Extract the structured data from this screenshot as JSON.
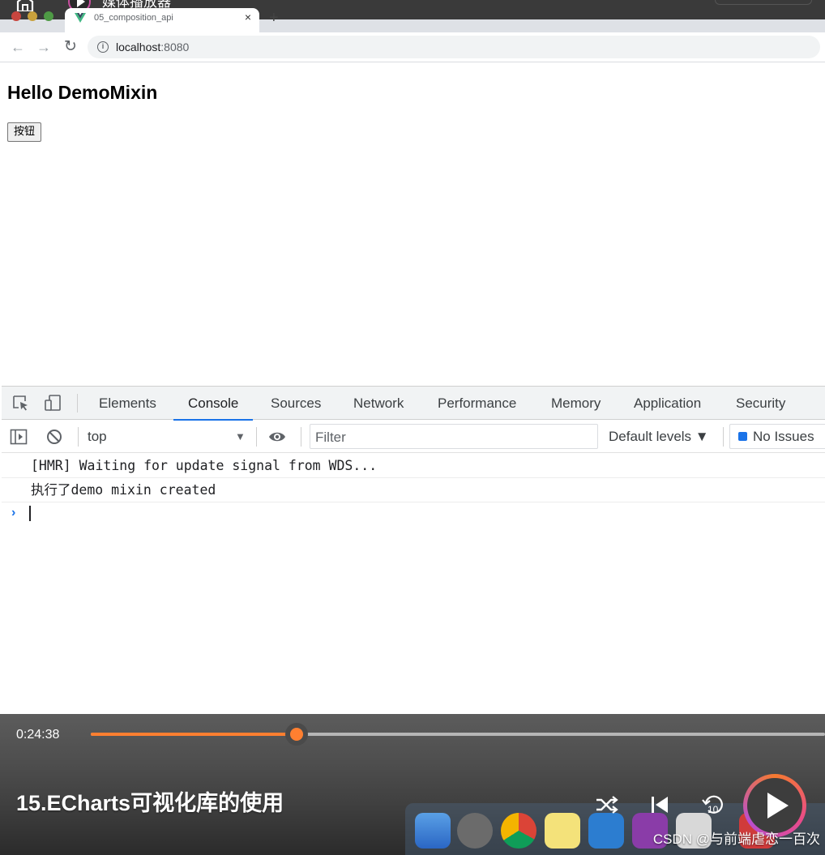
{
  "player": {
    "app_title": "媒体播放器",
    "current_time": "0:24:38",
    "progress_fraction": 0.28,
    "video_title": "15.ECharts可视化库的使用",
    "replay_seconds": "10",
    "watermark": "CSDN @与前端虐恋一百次",
    "accent_color": "#ff7f30"
  },
  "browser": {
    "tab": {
      "title": "05_composition_api",
      "close": "×"
    },
    "new_tab": "+",
    "url_host": "localhost",
    "url_port": ":8080"
  },
  "page": {
    "heading": "Hello DemoMixin",
    "button_label": "按钮"
  },
  "devtools": {
    "tabs": [
      "Elements",
      "Console",
      "Sources",
      "Network",
      "Performance",
      "Memory",
      "Application",
      "Security"
    ],
    "active_tab": "Console",
    "context": "top",
    "filter_placeholder": "Filter",
    "levels": "Default levels ▼",
    "issues": "No Issues",
    "console_lines": [
      "[HMR] Waiting for update signal from WDS...",
      "执行了demo mixin created"
    ]
  },
  "icons": {
    "inspect": "inspect-element-icon",
    "device": "device-toolbar-icon",
    "sidebar": "console-sidebar-icon",
    "clear": "clear-console-icon",
    "eye": "live-expression-icon"
  }
}
